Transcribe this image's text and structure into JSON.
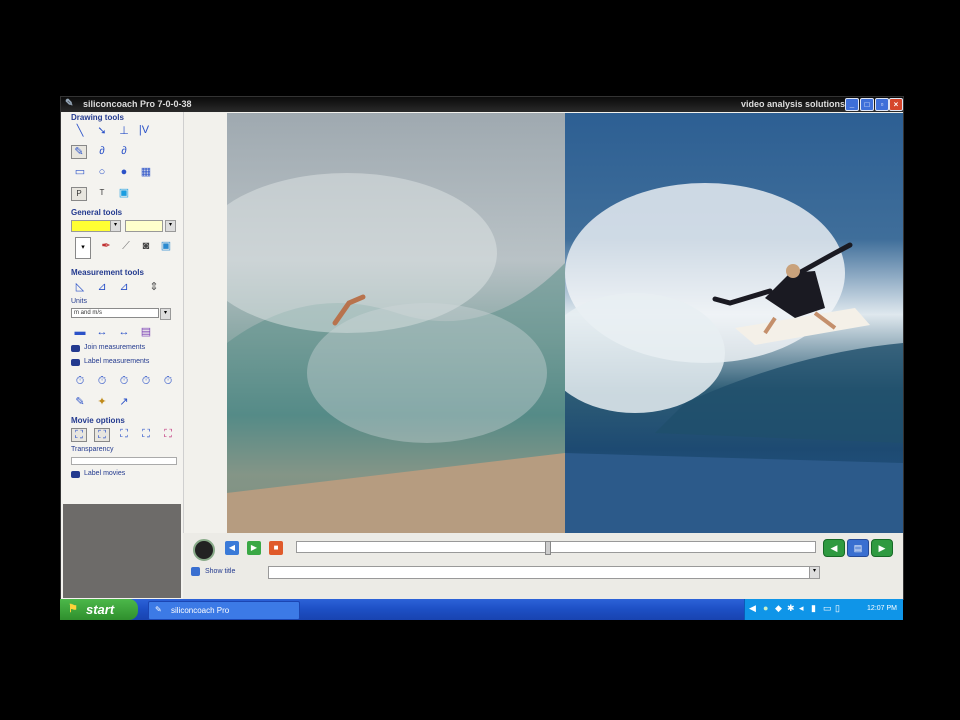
{
  "window": {
    "title": "siliconcoach Pro 7-0-0-38",
    "brand_text": "video analysis solutions"
  },
  "sidebar": {
    "drawing_tools_label": "Drawing tools",
    "general_tools_label": "General tools",
    "measurement_tools_label": "Measurement tools",
    "units_label": "Units",
    "units_value": "m and m/s",
    "join_measurements_label": "Join measurements",
    "label_measurements_label": "Label measurements",
    "movie_options_label": "Movie options",
    "transparency_label": "Transparency",
    "label_movies_label": "Label movies",
    "tool_text_p": "P",
    "tool_text_t": "T"
  },
  "controls": {
    "show_title_label": "Show title"
  },
  "taskbar": {
    "start_label": "start",
    "task_label": "siliconcoach Pro",
    "clock": "12:07 PM"
  },
  "colors": {
    "accent_yellow": "#ffff33",
    "title_blue": "#233a8f",
    "taskbar_blue": "#1d4fc4"
  }
}
